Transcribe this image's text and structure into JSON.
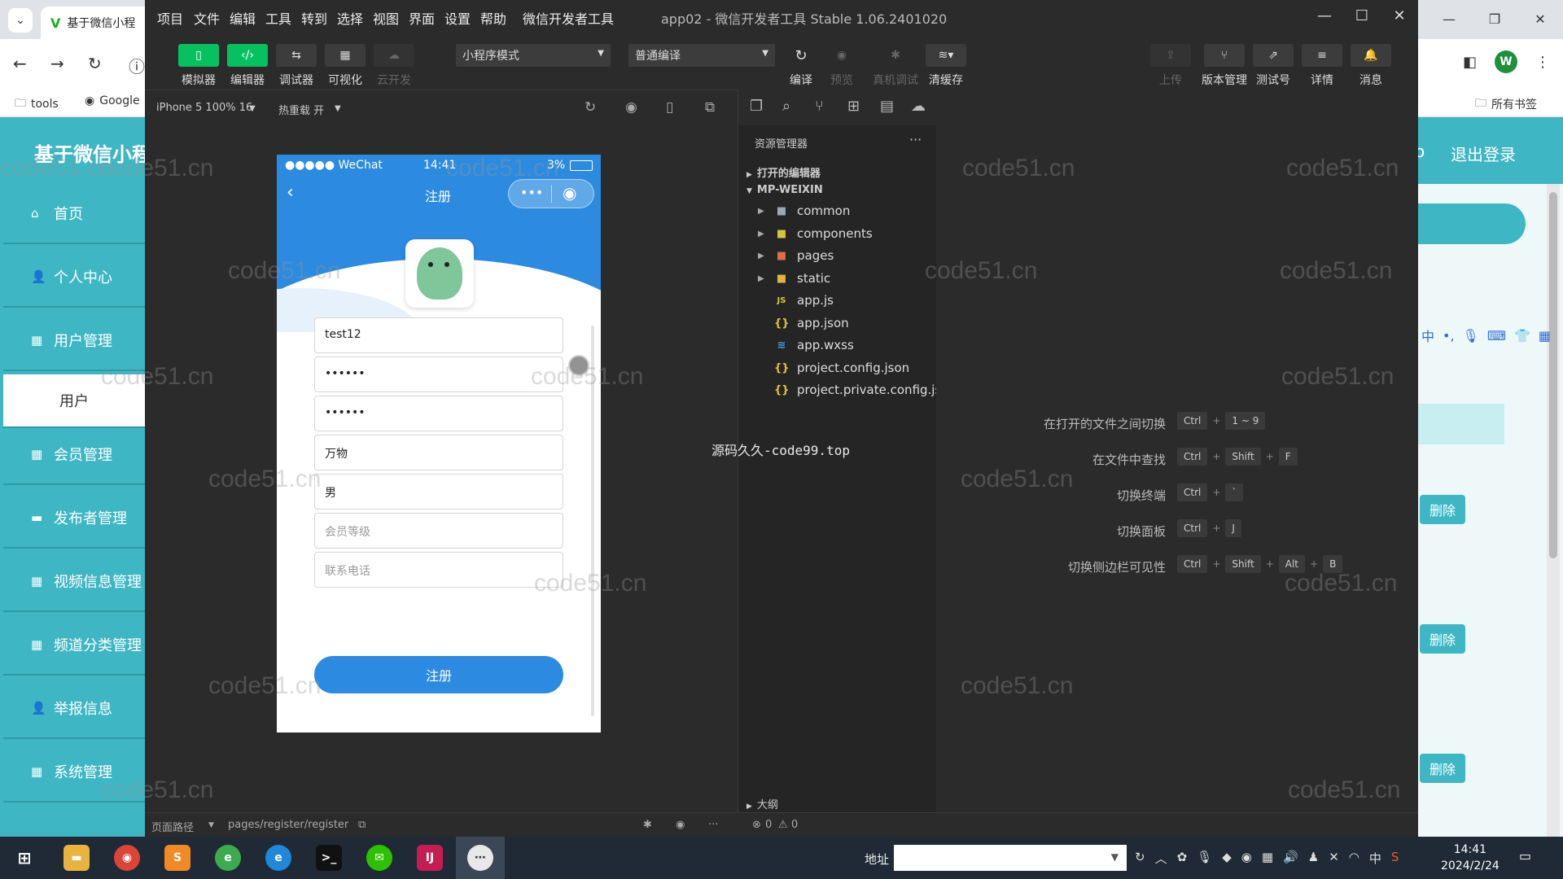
{
  "browser": {
    "tab_title": "基于微信小程",
    "bookmarks": [
      "tools",
      "Google"
    ],
    "bookmark_right": "所有书签",
    "avatar_letter": "W"
  },
  "admin": {
    "title": "基于微信小程",
    "header_o": "o",
    "logout": "退出登录",
    "sidebar": [
      "首页",
      "个人中心",
      "用户管理",
      "用户",
      "会员管理",
      "发布者管理",
      "视频信息管理",
      "频道分类管理",
      "举报信息",
      "系统管理"
    ],
    "delete_label": "删除"
  },
  "devtools": {
    "menu": [
      "项目",
      "文件",
      "编辑",
      "工具",
      "转到",
      "选择",
      "视图",
      "界面",
      "设置",
      "帮助",
      "微信开发者工具"
    ],
    "app_title": "app02 - 微信开发者工具 Stable 1.06.2401020",
    "toolbar_left": [
      {
        "label": "模拟器",
        "icon": "▯"
      },
      {
        "label": "编辑器",
        "icon": "‹/›"
      },
      {
        "label": "调试器",
        "icon": "⇆"
      },
      {
        "label": "可视化",
        "icon": "▦"
      },
      {
        "label": "云开发",
        "icon": "☁"
      }
    ],
    "mode_select": "小程序模式",
    "compile_select": "普通编译",
    "toolbar_mid": [
      "编译",
      "预览",
      "真机调试",
      "清缓存"
    ],
    "toolbar_right": [
      "上传",
      "版本管理",
      "测试号",
      "详情",
      "消息"
    ],
    "device": "iPhone 5 100% 16",
    "hot_reload": "热重载 开",
    "explorer": {
      "title": "资源管理器",
      "open_editors": "打开的编辑器",
      "root": "MP-WEIXIN",
      "items": [
        {
          "name": "common",
          "type": "folder"
        },
        {
          "name": "components",
          "type": "folder"
        },
        {
          "name": "pages",
          "type": "folder"
        },
        {
          "name": "static",
          "type": "folder"
        },
        {
          "name": "app.js",
          "type": "js"
        },
        {
          "name": "app.json",
          "type": "json"
        },
        {
          "name": "app.wxss",
          "type": "wxss"
        },
        {
          "name": "project.config.json",
          "type": "json"
        },
        {
          "name": "project.private.config.js...",
          "type": "json"
        }
      ],
      "outline": "大纲"
    },
    "shortcuts": [
      {
        "text": "在打开的文件之间切换",
        "keys": [
          "Ctrl",
          "1 ~ 9"
        ]
      },
      {
        "text": "在文件中查找",
        "keys": [
          "Ctrl",
          "Shift",
          "F"
        ]
      },
      {
        "text": "切换终端",
        "keys": [
          "Ctrl",
          "`"
        ]
      },
      {
        "text": "切换面板",
        "keys": [
          "Ctrl",
          "J"
        ]
      },
      {
        "text": "切换侧边栏可见性",
        "keys": [
          "Ctrl",
          "Shift",
          "Alt",
          "B"
        ]
      }
    ],
    "watermark_text": "源码久久-code99.top",
    "status_path_label": "页面路径",
    "status_path": "pages/register/register",
    "errors": "0",
    "warnings": "0"
  },
  "phone": {
    "carrier": "●●●●● WeChat",
    "time": "14:41",
    "battery": "3%",
    "nav_title": "注册",
    "fields": [
      {
        "value": "test12",
        "placeholder": ""
      },
      {
        "value": "••••••",
        "placeholder": ""
      },
      {
        "value": "••••••",
        "placeholder": ""
      },
      {
        "value": "万物",
        "placeholder": ""
      },
      {
        "value": "男",
        "placeholder": ""
      },
      {
        "value": "",
        "placeholder": "会员等级"
      },
      {
        "value": "",
        "placeholder": "联系电话"
      }
    ],
    "submit": "注册"
  },
  "watermark": "code51.cn",
  "taskbar": {
    "addr_label": "地址",
    "clock_time": "14:41",
    "clock_date": "2024/2/24",
    "tray_lang": "中"
  }
}
